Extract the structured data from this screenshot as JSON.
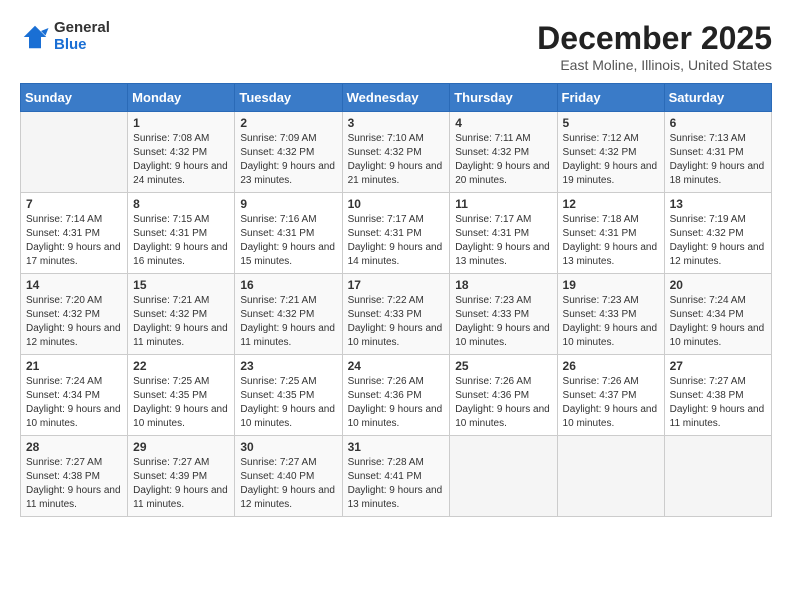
{
  "logo": {
    "general": "General",
    "blue": "Blue"
  },
  "header": {
    "month": "December 2025",
    "location": "East Moline, Illinois, United States"
  },
  "weekdays": [
    "Sunday",
    "Monday",
    "Tuesday",
    "Wednesday",
    "Thursday",
    "Friday",
    "Saturday"
  ],
  "weeks": [
    [
      {
        "day": "",
        "sunrise": "",
        "sunset": "",
        "daylight": ""
      },
      {
        "day": "1",
        "sunrise": "Sunrise: 7:08 AM",
        "sunset": "Sunset: 4:32 PM",
        "daylight": "Daylight: 9 hours and 24 minutes."
      },
      {
        "day": "2",
        "sunrise": "Sunrise: 7:09 AM",
        "sunset": "Sunset: 4:32 PM",
        "daylight": "Daylight: 9 hours and 23 minutes."
      },
      {
        "day": "3",
        "sunrise": "Sunrise: 7:10 AM",
        "sunset": "Sunset: 4:32 PM",
        "daylight": "Daylight: 9 hours and 21 minutes."
      },
      {
        "day": "4",
        "sunrise": "Sunrise: 7:11 AM",
        "sunset": "Sunset: 4:32 PM",
        "daylight": "Daylight: 9 hours and 20 minutes."
      },
      {
        "day": "5",
        "sunrise": "Sunrise: 7:12 AM",
        "sunset": "Sunset: 4:32 PM",
        "daylight": "Daylight: 9 hours and 19 minutes."
      },
      {
        "day": "6",
        "sunrise": "Sunrise: 7:13 AM",
        "sunset": "Sunset: 4:31 PM",
        "daylight": "Daylight: 9 hours and 18 minutes."
      }
    ],
    [
      {
        "day": "7",
        "sunrise": "Sunrise: 7:14 AM",
        "sunset": "Sunset: 4:31 PM",
        "daylight": "Daylight: 9 hours and 17 minutes."
      },
      {
        "day": "8",
        "sunrise": "Sunrise: 7:15 AM",
        "sunset": "Sunset: 4:31 PM",
        "daylight": "Daylight: 9 hours and 16 minutes."
      },
      {
        "day": "9",
        "sunrise": "Sunrise: 7:16 AM",
        "sunset": "Sunset: 4:31 PM",
        "daylight": "Daylight: 9 hours and 15 minutes."
      },
      {
        "day": "10",
        "sunrise": "Sunrise: 7:17 AM",
        "sunset": "Sunset: 4:31 PM",
        "daylight": "Daylight: 9 hours and 14 minutes."
      },
      {
        "day": "11",
        "sunrise": "Sunrise: 7:17 AM",
        "sunset": "Sunset: 4:31 PM",
        "daylight": "Daylight: 9 hours and 13 minutes."
      },
      {
        "day": "12",
        "sunrise": "Sunrise: 7:18 AM",
        "sunset": "Sunset: 4:31 PM",
        "daylight": "Daylight: 9 hours and 13 minutes."
      },
      {
        "day": "13",
        "sunrise": "Sunrise: 7:19 AM",
        "sunset": "Sunset: 4:32 PM",
        "daylight": "Daylight: 9 hours and 12 minutes."
      }
    ],
    [
      {
        "day": "14",
        "sunrise": "Sunrise: 7:20 AM",
        "sunset": "Sunset: 4:32 PM",
        "daylight": "Daylight: 9 hours and 12 minutes."
      },
      {
        "day": "15",
        "sunrise": "Sunrise: 7:21 AM",
        "sunset": "Sunset: 4:32 PM",
        "daylight": "Daylight: 9 hours and 11 minutes."
      },
      {
        "day": "16",
        "sunrise": "Sunrise: 7:21 AM",
        "sunset": "Sunset: 4:32 PM",
        "daylight": "Daylight: 9 hours and 11 minutes."
      },
      {
        "day": "17",
        "sunrise": "Sunrise: 7:22 AM",
        "sunset": "Sunset: 4:33 PM",
        "daylight": "Daylight: 9 hours and 10 minutes."
      },
      {
        "day": "18",
        "sunrise": "Sunrise: 7:23 AM",
        "sunset": "Sunset: 4:33 PM",
        "daylight": "Daylight: 9 hours and 10 minutes."
      },
      {
        "day": "19",
        "sunrise": "Sunrise: 7:23 AM",
        "sunset": "Sunset: 4:33 PM",
        "daylight": "Daylight: 9 hours and 10 minutes."
      },
      {
        "day": "20",
        "sunrise": "Sunrise: 7:24 AM",
        "sunset": "Sunset: 4:34 PM",
        "daylight": "Daylight: 9 hours and 10 minutes."
      }
    ],
    [
      {
        "day": "21",
        "sunrise": "Sunrise: 7:24 AM",
        "sunset": "Sunset: 4:34 PM",
        "daylight": "Daylight: 9 hours and 10 minutes."
      },
      {
        "day": "22",
        "sunrise": "Sunrise: 7:25 AM",
        "sunset": "Sunset: 4:35 PM",
        "daylight": "Daylight: 9 hours and 10 minutes."
      },
      {
        "day": "23",
        "sunrise": "Sunrise: 7:25 AM",
        "sunset": "Sunset: 4:35 PM",
        "daylight": "Daylight: 9 hours and 10 minutes."
      },
      {
        "day": "24",
        "sunrise": "Sunrise: 7:26 AM",
        "sunset": "Sunset: 4:36 PM",
        "daylight": "Daylight: 9 hours and 10 minutes."
      },
      {
        "day": "25",
        "sunrise": "Sunrise: 7:26 AM",
        "sunset": "Sunset: 4:36 PM",
        "daylight": "Daylight: 9 hours and 10 minutes."
      },
      {
        "day": "26",
        "sunrise": "Sunrise: 7:26 AM",
        "sunset": "Sunset: 4:37 PM",
        "daylight": "Daylight: 9 hours and 10 minutes."
      },
      {
        "day": "27",
        "sunrise": "Sunrise: 7:27 AM",
        "sunset": "Sunset: 4:38 PM",
        "daylight": "Daylight: 9 hours and 11 minutes."
      }
    ],
    [
      {
        "day": "28",
        "sunrise": "Sunrise: 7:27 AM",
        "sunset": "Sunset: 4:38 PM",
        "daylight": "Daylight: 9 hours and 11 minutes."
      },
      {
        "day": "29",
        "sunrise": "Sunrise: 7:27 AM",
        "sunset": "Sunset: 4:39 PM",
        "daylight": "Daylight: 9 hours and 11 minutes."
      },
      {
        "day": "30",
        "sunrise": "Sunrise: 7:27 AM",
        "sunset": "Sunset: 4:40 PM",
        "daylight": "Daylight: 9 hours and 12 minutes."
      },
      {
        "day": "31",
        "sunrise": "Sunrise: 7:28 AM",
        "sunset": "Sunset: 4:41 PM",
        "daylight": "Daylight: 9 hours and 13 minutes."
      },
      {
        "day": "",
        "sunrise": "",
        "sunset": "",
        "daylight": ""
      },
      {
        "day": "",
        "sunrise": "",
        "sunset": "",
        "daylight": ""
      },
      {
        "day": "",
        "sunrise": "",
        "sunset": "",
        "daylight": ""
      }
    ]
  ]
}
